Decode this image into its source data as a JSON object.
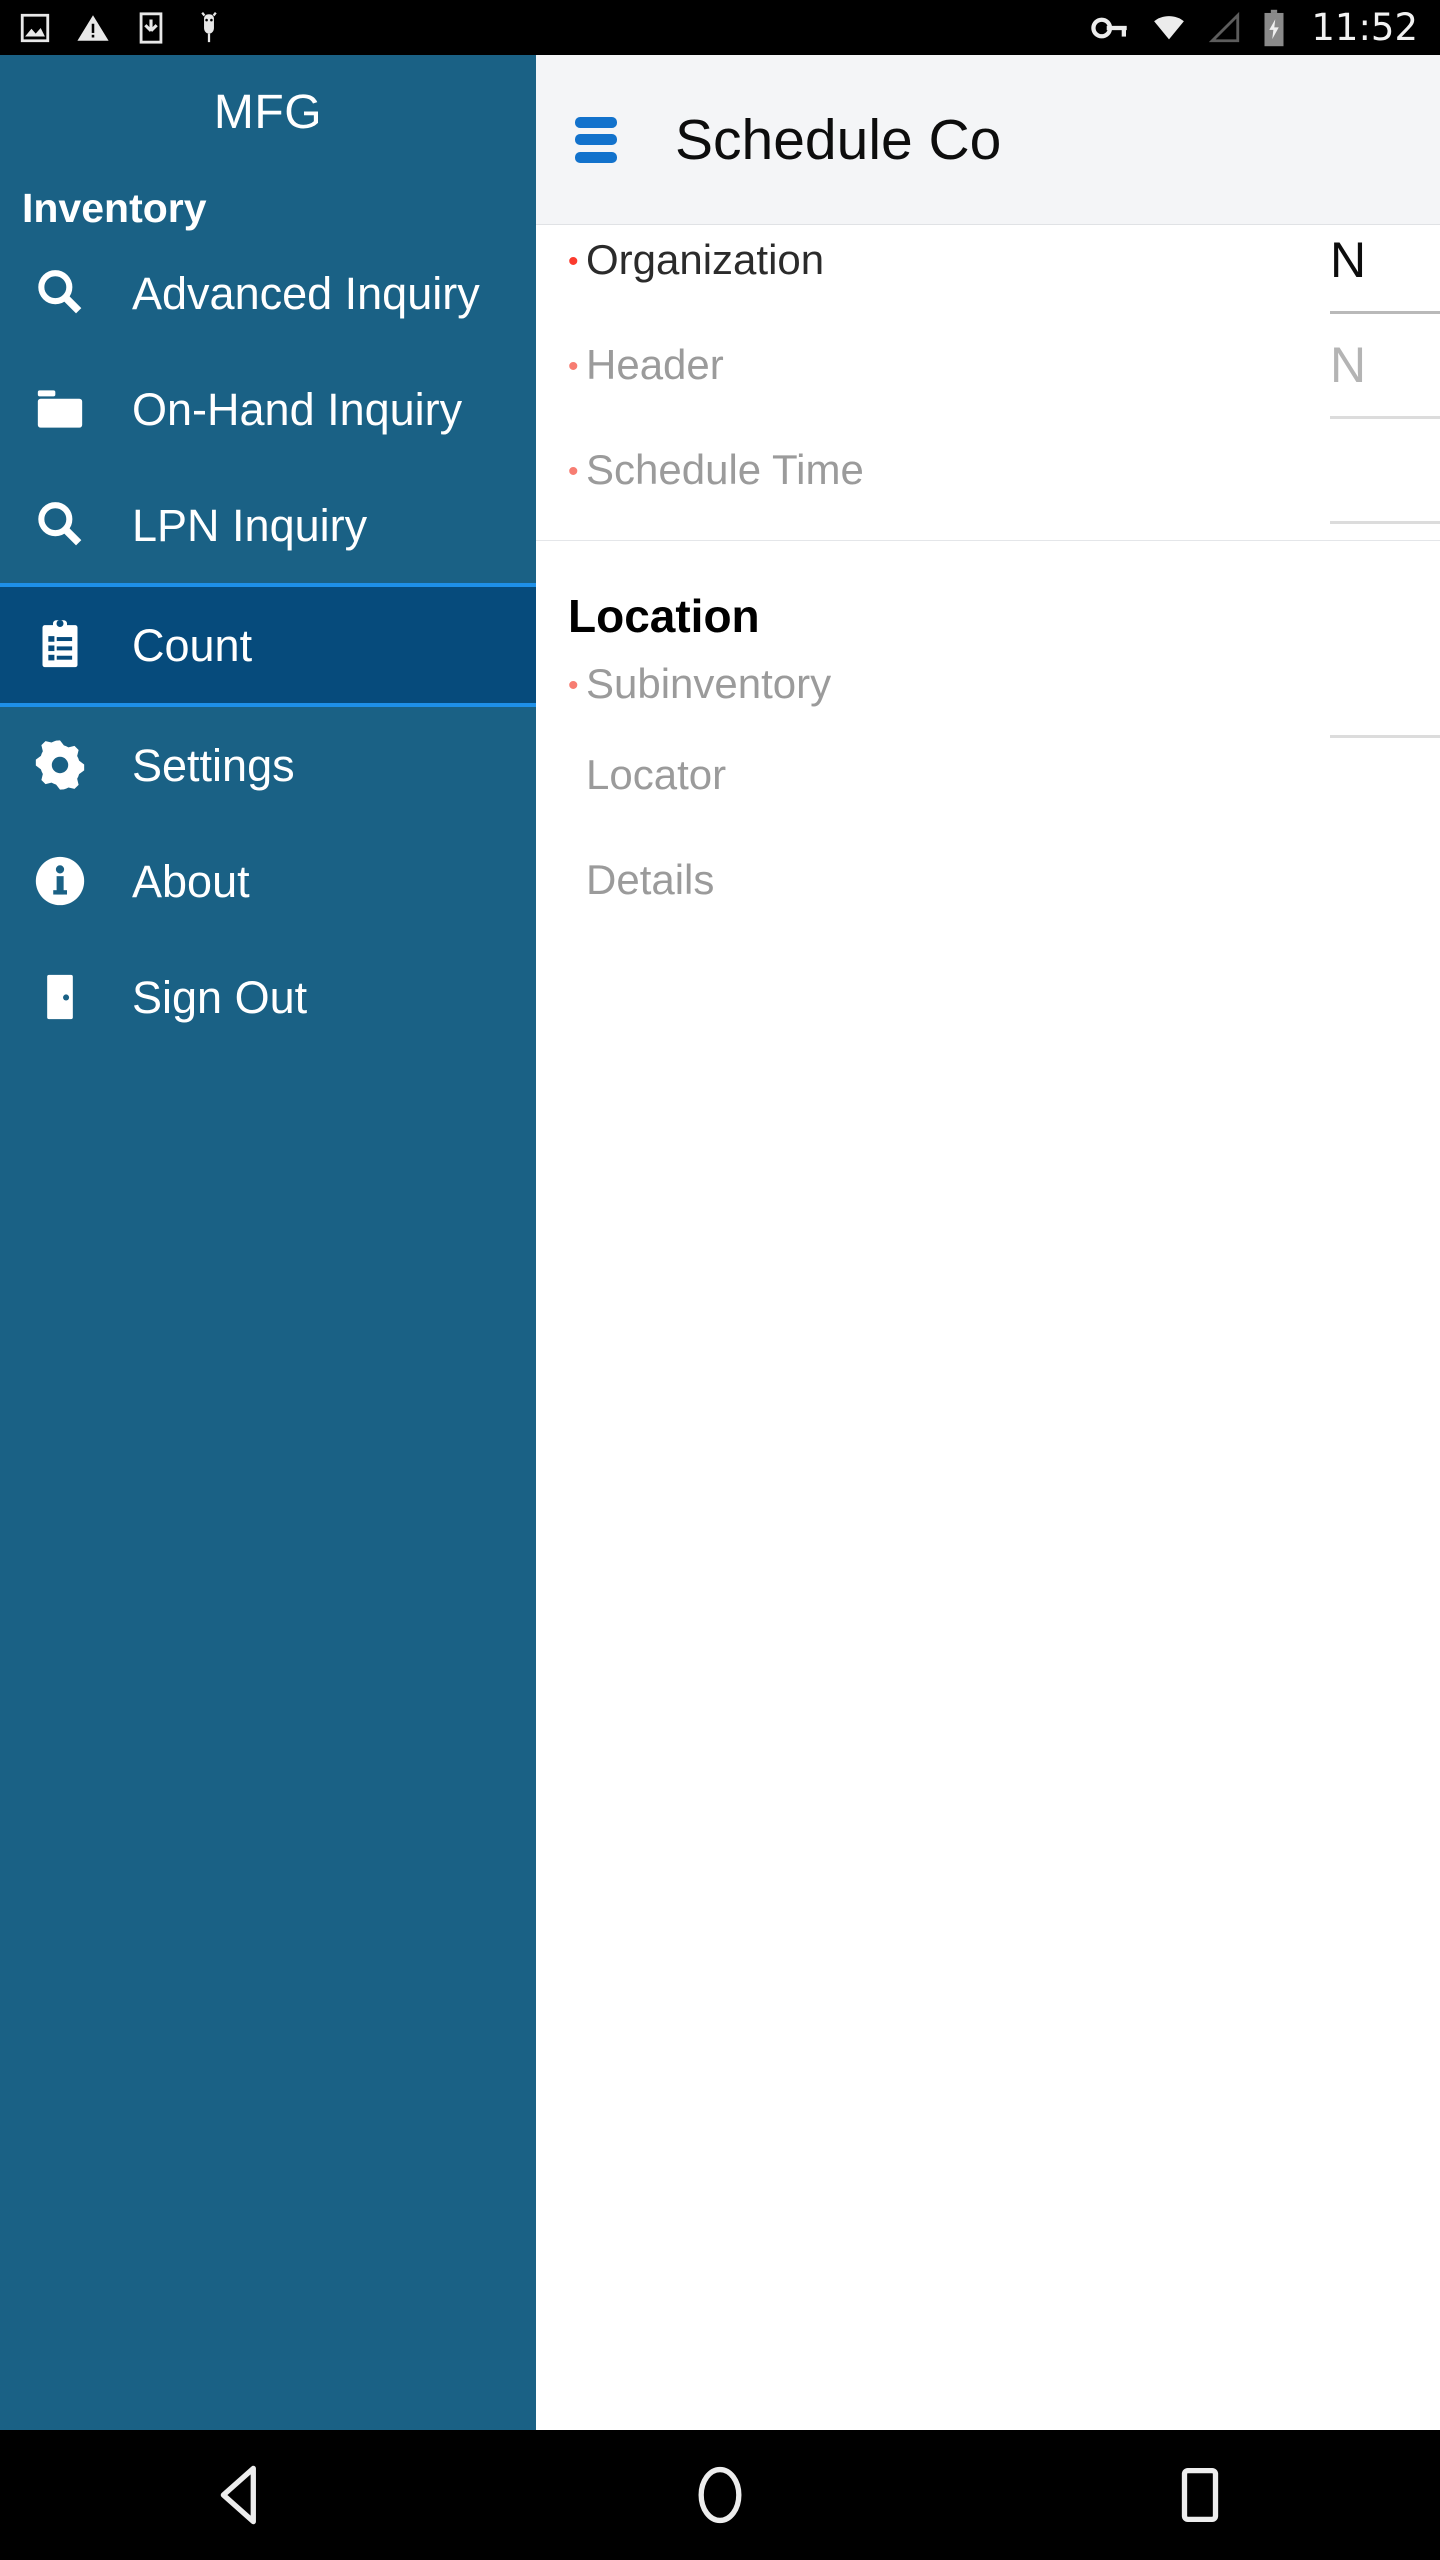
{
  "status_bar": {
    "clock": "11:52",
    "left_icons": [
      "image-icon",
      "warning-icon",
      "download-icon",
      "android-debug-icon"
    ],
    "right_icons": [
      "vpn-key-icon",
      "wifi-icon",
      "cell-signal-icon",
      "battery-charging-icon"
    ]
  },
  "app_bar": {
    "menu_icon": "hamburger-icon",
    "title": "Schedule Co"
  },
  "drawer": {
    "title": "MFG",
    "group_label": "Inventory",
    "items": [
      {
        "label": "Advanced Inquiry",
        "icon": "search-icon",
        "selected": false
      },
      {
        "label": "On-Hand Inquiry",
        "icon": "folder-icon",
        "selected": false
      },
      {
        "label": "LPN Inquiry",
        "icon": "search-icon",
        "selected": false
      },
      {
        "label": "Count",
        "icon": "clipboard-list-icon",
        "selected": true
      },
      {
        "label": "Settings",
        "icon": "gear-icon",
        "selected": false
      },
      {
        "label": "About",
        "icon": "info-circle-icon",
        "selected": false
      },
      {
        "label": "Sign Out",
        "icon": "door-exit-icon",
        "selected": false
      }
    ],
    "colors": {
      "background": "#1a6185",
      "selected_background": "#064b7c",
      "selected_border": "#1e90e8"
    }
  },
  "form": {
    "top_section": {
      "fields": [
        {
          "label": "Organization",
          "required": true,
          "state": "active",
          "value": "N"
        },
        {
          "label": "Header",
          "required": true,
          "state": "inactive",
          "value": "N"
        },
        {
          "label": "Schedule Time",
          "required": true,
          "state": "inactive",
          "value": ""
        }
      ]
    },
    "location_section": {
      "title": "Location",
      "fields": [
        {
          "label": "Subinventory",
          "required": true,
          "state": "inactive",
          "value": ""
        },
        {
          "label": "Locator",
          "required": false,
          "state": "inactive",
          "value": ""
        },
        {
          "label": "Details",
          "required": false,
          "state": "inactive",
          "value": ""
        }
      ]
    },
    "required_marker": "•",
    "colors": {
      "required_dot": "#fb3b2e",
      "required_dot_muted": "#f77d72",
      "accent": "#1272cc"
    }
  },
  "nav_bar": {
    "buttons": [
      {
        "name": "back-button",
        "icon": "triangle-left-icon"
      },
      {
        "name": "home-button",
        "icon": "circle-icon"
      },
      {
        "name": "recents-button",
        "icon": "square-icon"
      }
    ]
  }
}
